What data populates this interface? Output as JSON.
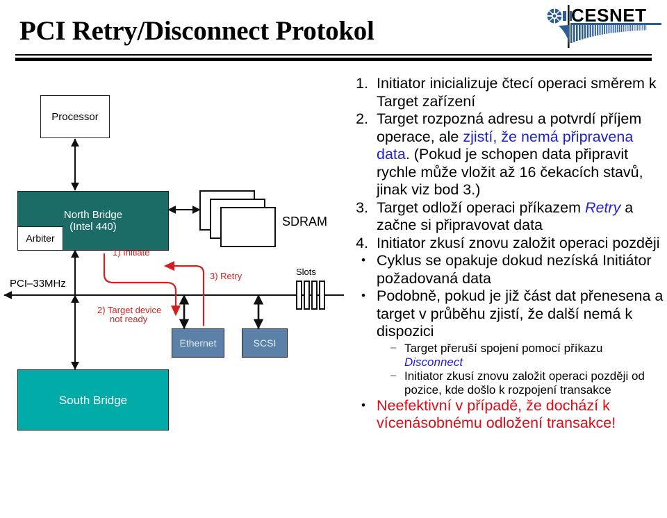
{
  "header": {
    "title": "PCI Retry/Disconnect Protokol",
    "logo_text": "CESNET",
    "logo_accent_color": "#2b5e96"
  },
  "diagram": {
    "boxes": {
      "processor": "Processor",
      "north_bridge_line1": "North Bridge",
      "north_bridge_line2": "(Intel 440)",
      "arbiter": "Arbiter",
      "south_bridge": "South Bridge",
      "ethernet": "Ethernet",
      "scsi": "SCSI"
    },
    "labels": {
      "sdram": "SDRAM",
      "slots": "Slots",
      "bus": "PCI–33MHz"
    },
    "annotations": {
      "step1": "1) Initiate",
      "step2_line1": "2) Target device",
      "step2_line2": "not ready",
      "step3": "3) Retry"
    },
    "colors": {
      "north_bridge": "#1b6b66",
      "south_bridge": "#00aba8",
      "device": "#5b81a8",
      "annotation_red": "#d21f1f"
    }
  },
  "content": {
    "steps": [
      {
        "number": "1.",
        "parts": [
          {
            "text": "Initiator inicializuje čtecí operaci směrem k Target zařízení",
            "style": "plain"
          }
        ]
      },
      {
        "number": "2.",
        "parts": [
          {
            "text": "Target rozpozná adresu a potvrdí příjem operace, ale ",
            "style": "plain"
          },
          {
            "text": "zjistí, že nemá připravena data",
            "style": "blue"
          },
          {
            "text": ". (Pokud je schopen data připravit rychle může vložit až 16 čekacích stavů, jinak viz bod 3.)",
            "style": "plain"
          }
        ]
      },
      {
        "number": "3.",
        "parts": [
          {
            "text": "Target odloží operaci příkazem ",
            "style": "plain"
          },
          {
            "text": "Retry",
            "style": "blue-italic"
          },
          {
            "text": " a začne si připravovat data",
            "style": "plain"
          }
        ]
      },
      {
        "number": "4.",
        "parts": [
          {
            "text": "Initiator zkusí znovu založit operaci později",
            "style": "plain"
          }
        ]
      }
    ],
    "bullets": [
      {
        "parts": [
          {
            "text": "Cyklus se opakuje dokud nezíská Initiátor požadovaná data",
            "style": "plain"
          }
        ],
        "sub": []
      },
      {
        "parts": [
          {
            "text": "Podobně, pokud je již část dat přenesena a target v průběhu zjistí, že další nemá k dispozici",
            "style": "plain"
          }
        ],
        "sub": [
          {
            "parts": [
              {
                "text": "Target přeruší spojení pomocí příkazu ",
                "style": "plain"
              },
              {
                "text": "Disconnect",
                "style": "blue-italic"
              }
            ]
          },
          {
            "parts": [
              {
                "text": "Initiator zkusí znovu založit operaci později od pozice, kde došlo k rozpojení transakce",
                "style": "plain"
              }
            ]
          }
        ]
      },
      {
        "parts": [
          {
            "text": "Neefektivní v případě, že dochází k vícenásobnému odložení transakce!",
            "style": "red"
          }
        ],
        "sub": []
      }
    ]
  }
}
